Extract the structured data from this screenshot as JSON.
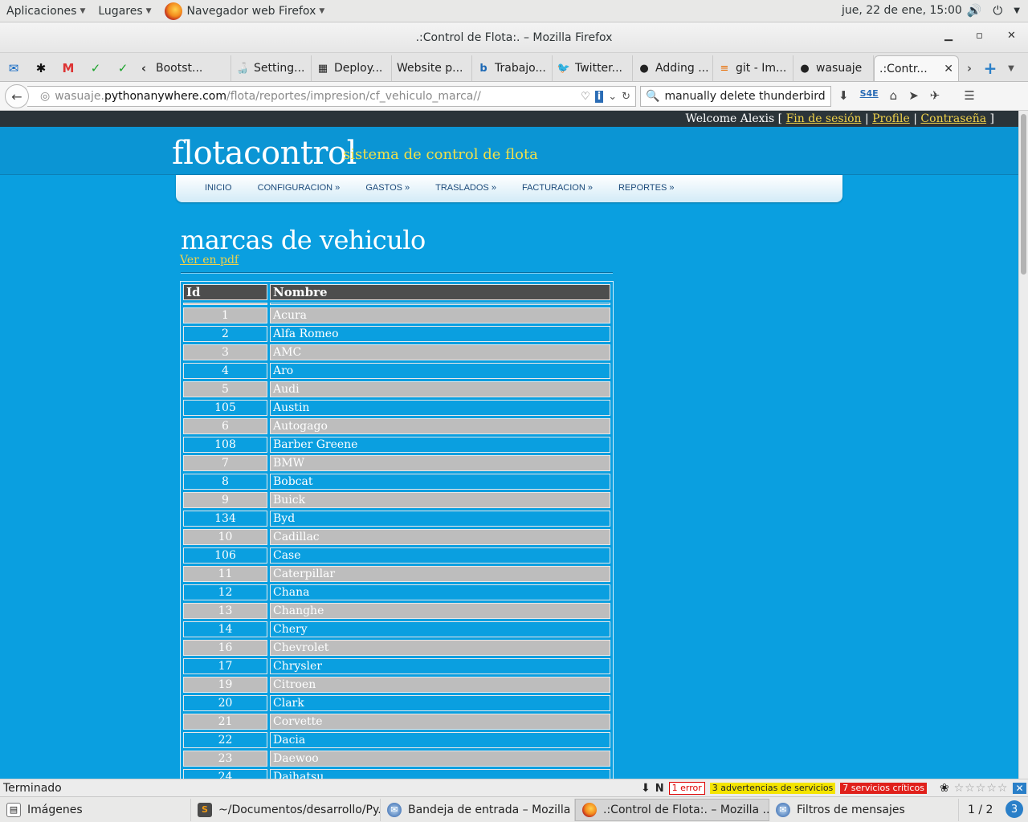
{
  "topbar": {
    "applications": "Aplicaciones",
    "places": "Lugares",
    "browser": "Navegador web Firefox",
    "datetime": "jue, 22 de ene, 15:00"
  },
  "window": {
    "title": ".:Control de Flota:. – Mozilla Firefox"
  },
  "tabs": [
    {
      "label": "Bootst..."
    },
    {
      "label": "Setting..."
    },
    {
      "label": "Deploy..."
    },
    {
      "label": "Website p..."
    },
    {
      "label": "Trabajo..."
    },
    {
      "label": "Twitter..."
    },
    {
      "label": "Adding ..."
    },
    {
      "label": "git - Im..."
    },
    {
      "label": "wasuaje"
    },
    {
      "label": ".:Contr..."
    }
  ],
  "navbar": {
    "url_prefix": "wasuaje.",
    "url_host": "pythonanywhere.com",
    "url_path": "/flota/reportes/impresion/cf_vehiculo_marca//",
    "search_value": "manually delete  thunderbird"
  },
  "site": {
    "welcome": "Welcome Alexis [",
    "logout": "Fin de sesión",
    "profile": "Profile",
    "password": "Contraseña",
    "sep1": "|",
    "sep2": "|",
    "close_bracket": "]",
    "brand": "flotacontrol",
    "tagline": "sistema de control de flota",
    "menu": [
      "INICIO",
      "CONFIGURACION »",
      "GASTOS »",
      "TRASLADOS »",
      "FACTURACION »",
      "REPORTES »"
    ],
    "page_title": "marcas de vehiculo",
    "pdf_link": "Ver en pdf"
  },
  "table": {
    "headers": [
      "Id",
      "Nombre"
    ],
    "rows": [
      [
        "1",
        "Acura"
      ],
      [
        "2",
        "Alfa Romeo"
      ],
      [
        "3",
        "AMC"
      ],
      [
        "4",
        "Aro"
      ],
      [
        "5",
        "Audi"
      ],
      [
        "105",
        "Austin"
      ],
      [
        "6",
        "Autogago"
      ],
      [
        "108",
        "Barber Greene"
      ],
      [
        "7",
        "BMW"
      ],
      [
        "8",
        "Bobcat"
      ],
      [
        "9",
        "Buick"
      ],
      [
        "134",
        "Byd"
      ],
      [
        "10",
        "Cadillac"
      ],
      [
        "106",
        "Case"
      ],
      [
        "11",
        "Caterpillar"
      ],
      [
        "12",
        "Chana"
      ],
      [
        "13",
        "Changhe"
      ],
      [
        "14",
        "Chery"
      ],
      [
        "16",
        "Chevrolet"
      ],
      [
        "17",
        "Chrysler"
      ],
      [
        "19",
        "Citroen"
      ],
      [
        "20",
        "Clark"
      ],
      [
        "21",
        "Corvette"
      ],
      [
        "22",
        "Dacia"
      ],
      [
        "23",
        "Daewoo"
      ],
      [
        "24",
        "Daihatsu"
      ]
    ]
  },
  "statusbar": {
    "status": "Terminado",
    "errors": "1 error",
    "warnings": "3 advertencias de servicios",
    "critical": "7 servicios críticos"
  },
  "taskbar": {
    "items": [
      "Imágenes",
      "~/Documentos/desarrollo/Py...",
      "Bandeja de entrada – Mozilla ...",
      ".:Control de Flota:. – Mozilla ...",
      "Filtros de mensajes"
    ],
    "workspace": "1 / 2"
  },
  "colors": {
    "page_bg": "#0a9fe0",
    "header_bg": "#0b95d4",
    "link": "#f0d24a",
    "row_alt": "#bdbdbd",
    "th_bg": "#4d4d4d"
  }
}
